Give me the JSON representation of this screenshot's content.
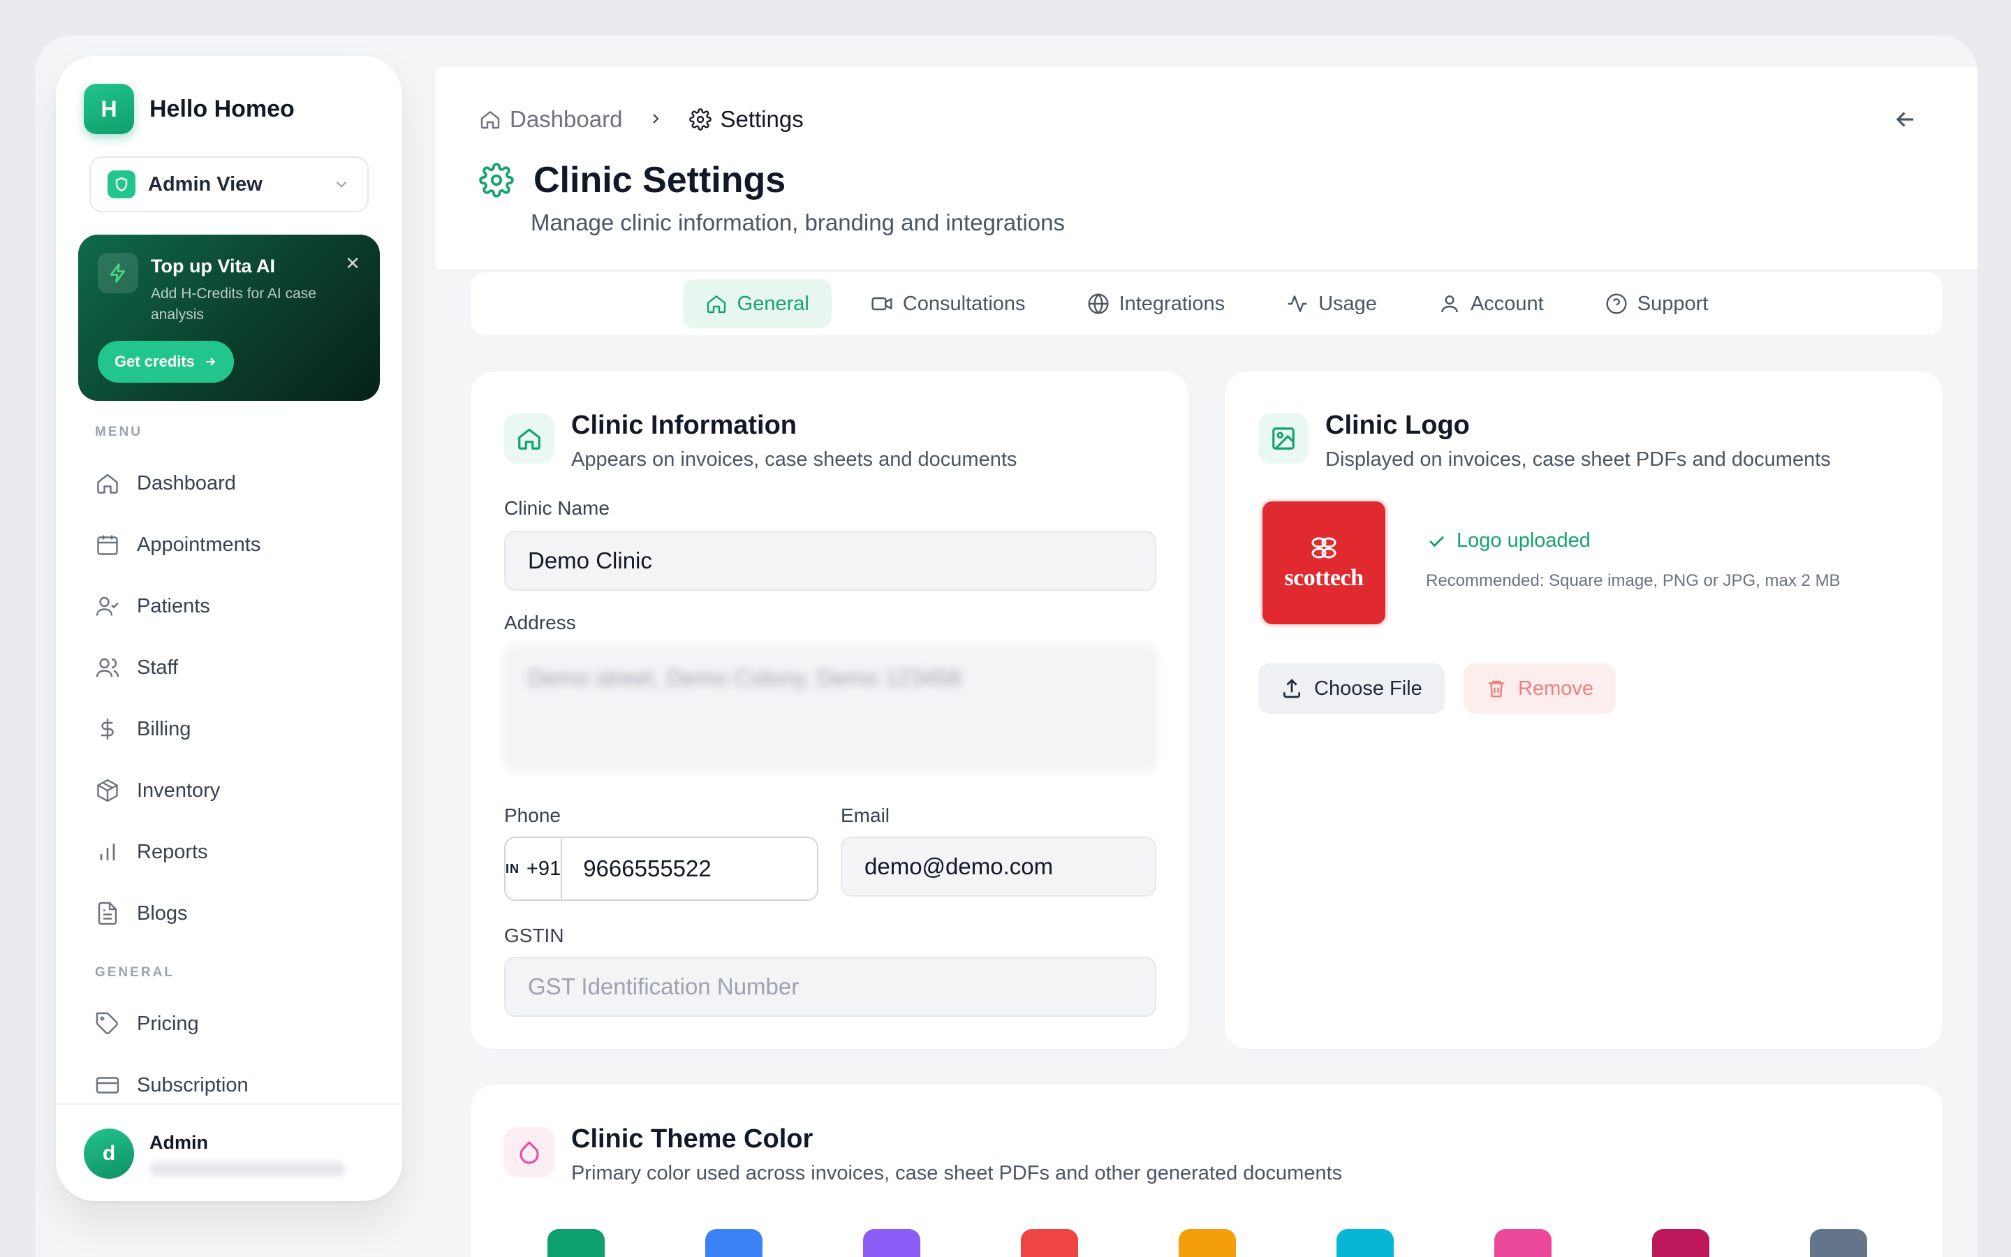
{
  "brand": {
    "initial": "H",
    "name": "Hello Homeo"
  },
  "view_select": {
    "label": "Admin View"
  },
  "promo": {
    "title": "Top up Vita AI",
    "subtitle": "Add H-Credits for AI case analysis",
    "button": "Get credits"
  },
  "sidebar": {
    "menu_label": "MENU",
    "menu": [
      {
        "label": "Dashboard",
        "icon": "home-icon"
      },
      {
        "label": "Appointments",
        "icon": "calendar-icon"
      },
      {
        "label": "Patients",
        "icon": "user-check-icon"
      },
      {
        "label": "Staff",
        "icon": "users-icon"
      },
      {
        "label": "Billing",
        "icon": "dollar-icon"
      },
      {
        "label": "Inventory",
        "icon": "package-icon"
      },
      {
        "label": "Reports",
        "icon": "bar-chart-icon"
      },
      {
        "label": "Blogs",
        "icon": "file-text-icon"
      }
    ],
    "general_label": "GENERAL",
    "general": [
      {
        "label": "Pricing",
        "icon": "tag-icon"
      },
      {
        "label": "Subscription",
        "icon": "credit-card-icon"
      }
    ]
  },
  "user": {
    "initial": "d",
    "name": "Admin"
  },
  "breadcrumb": {
    "parent": "Dashboard",
    "current": "Settings"
  },
  "page": {
    "title": "Clinic Settings",
    "subtitle": "Manage clinic information, branding and integrations"
  },
  "tabs": [
    {
      "label": "General",
      "active": true
    },
    {
      "label": "Consultations",
      "active": false
    },
    {
      "label": "Integrations",
      "active": false
    },
    {
      "label": "Usage",
      "active": false
    },
    {
      "label": "Account",
      "active": false
    },
    {
      "label": "Support",
      "active": false
    }
  ],
  "clinic_info": {
    "title": "Clinic Information",
    "subtitle": "Appears on invoices, case sheets and documents",
    "name_label": "Clinic Name",
    "name_value": "Demo Clinic",
    "address_label": "Address",
    "address_value": "Demo street, Demo Colony, Demo 123456",
    "phone_label": "Phone",
    "phone_country": "IN",
    "phone_code": "+91",
    "phone_value": "9666555522",
    "email_label": "Email",
    "email_value": "demo@demo.com",
    "gstin_label": "GSTIN",
    "gstin_placeholder": "GST Identification Number"
  },
  "clinic_logo": {
    "title": "Clinic Logo",
    "subtitle": "Displayed on invoices, case sheet PDFs and documents",
    "logo_text": "scottech",
    "status": "Logo uploaded",
    "hint": "Recommended: Square image, PNG or JPG, max 2 MB",
    "choose_label": "Choose File",
    "remove_label": "Remove"
  },
  "theme": {
    "title": "Clinic Theme Color",
    "subtitle": "Primary color used across invoices, case sheet PDFs and other generated documents",
    "swatches": [
      "#0e9f6e",
      "#3b82f6",
      "#8b5cf6",
      "#ef4444",
      "#f59e0b",
      "#06b6d4",
      "#ec4899",
      "#be185d",
      "#64748b"
    ]
  },
  "colors": {
    "accent": "#14a36f",
    "danger": "#ef4444"
  }
}
